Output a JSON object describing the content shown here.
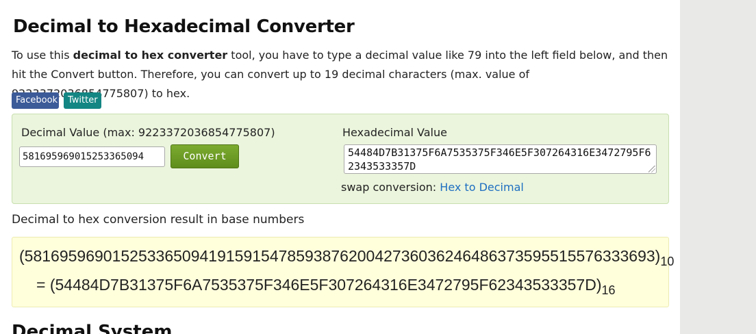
{
  "header": {
    "title": "Decimal to Hexadecimal Converter"
  },
  "intro": {
    "text_before": "To use this ",
    "bold": "decimal to hex converter",
    "text_after": " tool, you have to type a decimal value like 79 into the left field below, and then hit the Convert button. Therefore, you can convert up to 19 decimal characters (max. value of 9223372036854775807) to hex."
  },
  "share": {
    "facebook_label": "Facebook",
    "twitter_label": "Twitter"
  },
  "converter": {
    "decimal_label": "Decimal Value (max: 9223372036854775807)",
    "decimal_value": "58169596901525336509419159154785938762004273603624648637359551557633369​3",
    "decimal_visible": "581695969015253365094",
    "convert_label": "Convert",
    "hex_label": "Hexadecimal Value",
    "hex_value": "54484D7B31375F6A7535375F346E5F307264316E3472795F62343533357D",
    "swap_prefix": "swap conversion: ",
    "swap_link": "Hex to Decimal"
  },
  "result": {
    "title": "Decimal to hex conversion result in base numbers",
    "decimal_expr": "(581695969015253365094191591547859387620042736036246486373595515576333693)",
    "decimal_base": "10",
    "hex_expr": "= (54484D7B31375F6A7535375F346E5F307264316E3472795F62343533357D)",
    "hex_base": "16"
  },
  "next_section": {
    "title": "Decimal System"
  },
  "colors": {
    "facebook": "#3b5a98",
    "twitter": "#138683",
    "converter_bg": "#ebf5dd",
    "convert_button": "#6c9b24",
    "link": "#1e6fc1",
    "result_bg": "#ffffdc"
  }
}
